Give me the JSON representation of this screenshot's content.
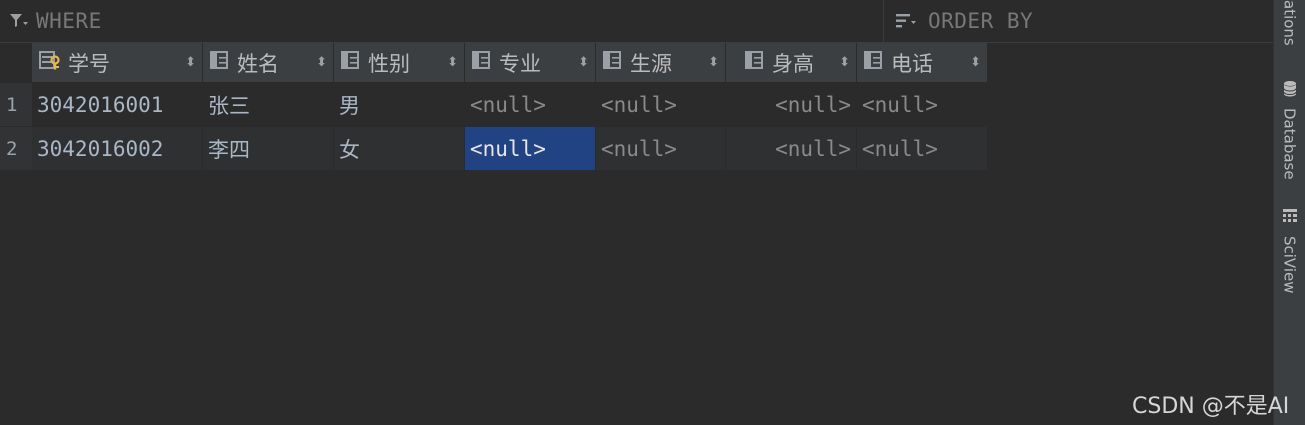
{
  "filter": {
    "where_placeholder": "WHERE",
    "orderby_placeholder": "ORDER BY"
  },
  "columns": [
    {
      "label": "学号",
      "icon": "primary-key-column-icon"
    },
    {
      "label": "姓名",
      "icon": "column-icon"
    },
    {
      "label": "性别",
      "icon": "column-icon"
    },
    {
      "label": "专业",
      "icon": "column-icon"
    },
    {
      "label": "生源",
      "icon": "column-icon"
    },
    {
      "label": "身高",
      "icon": "column-icon"
    },
    {
      "label": "电话",
      "icon": "column-icon"
    }
  ],
  "rows": [
    {
      "num": "1",
      "cells": [
        "3042016001",
        "张三",
        "男",
        "<null>",
        "<null>",
        "<null>",
        "<null>"
      ]
    },
    {
      "num": "2",
      "cells": [
        "3042016002",
        "李四",
        "女",
        "<null>",
        "<null>",
        "<null>",
        "<null>"
      ]
    }
  ],
  "sidebar": {
    "tabs": [
      {
        "label": "ations",
        "icon": ""
      },
      {
        "label": "Database",
        "icon": "database-icon"
      },
      {
        "label": "SciView",
        "icon": "sciview-icon"
      }
    ]
  },
  "watermark": "CSDN @不是AI",
  "colors": {
    "background": "#2b2b2b",
    "header": "#3c3f41",
    "selection": "#214283"
  }
}
